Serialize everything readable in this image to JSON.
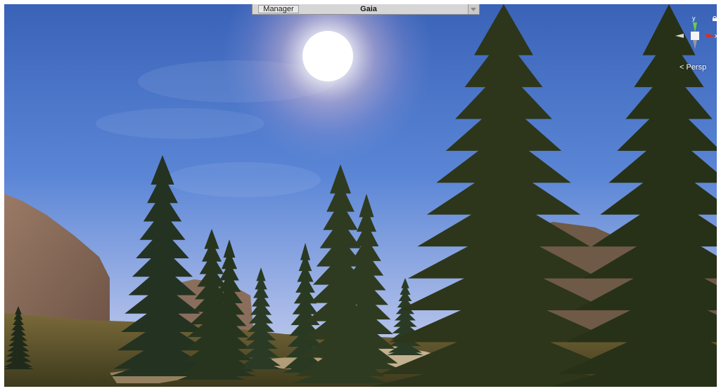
{
  "toolbar": {
    "manager_label": "Manager",
    "title": "Gaia"
  },
  "gizmo": {
    "projection_label": "< Persp",
    "axis_y": "y",
    "axis_x": "x"
  },
  "icons": {
    "dropdown": "chevron-down-icon",
    "lock": "lock-icon",
    "gizmo": "orientation-gizmo-icon"
  },
  "colors": {
    "sky_top": "#3a63b8",
    "sky_horizon": "#b9c9ea",
    "sun": "#ffffff",
    "axis_y": "#6bd13a",
    "axis_x": "#d9301f"
  }
}
